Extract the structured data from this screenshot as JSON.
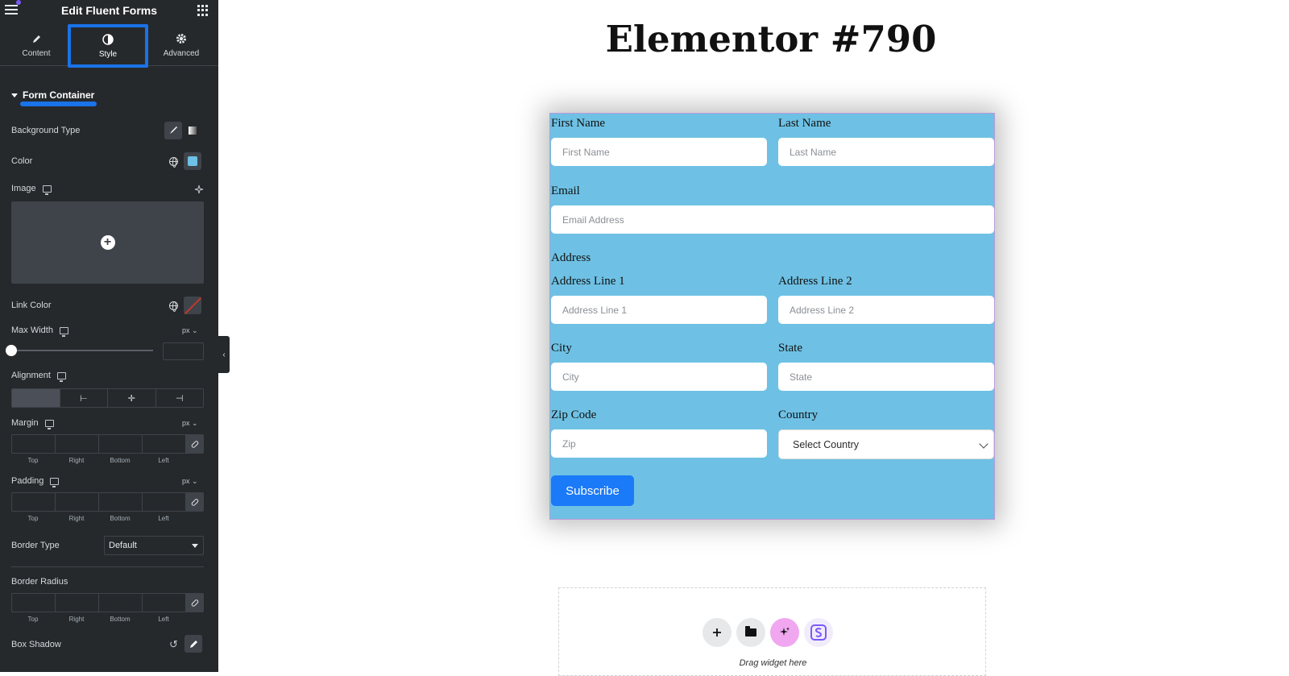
{
  "sidebar": {
    "title": "Edit Fluent Forms",
    "tabs": [
      {
        "label": "Content",
        "icon": "pencil-icon"
      },
      {
        "label": "Style",
        "icon": "half-circle-icon",
        "active": true
      },
      {
        "label": "Advanced",
        "icon": "gear-icon"
      }
    ],
    "section_title": "Form Container",
    "labels": {
      "background_type": "Background Type",
      "color": "Color",
      "image": "Image",
      "link_color": "Link Color",
      "max_width": "Max Width",
      "alignment": "Alignment",
      "margin": "Margin",
      "padding": "Padding",
      "border_type": "Border Type",
      "border_radius": "Border Radius",
      "box_shadow": "Box Shadow"
    },
    "unit": "px",
    "dimension_labels": {
      "top": "Top",
      "right": "Right",
      "bottom": "Bottom",
      "left": "Left"
    },
    "border_type_value": "Default",
    "colors": {
      "background_swatch": "#6ec1e4",
      "accent": "#1a73e8"
    }
  },
  "canvas": {
    "page_title": "Elementor #790",
    "form": {
      "first_name_label": "First Name",
      "first_name_placeholder": "First Name",
      "last_name_label": "Last Name",
      "last_name_placeholder": "Last Name",
      "email_label": "Email",
      "email_placeholder": "Email Address",
      "address_label": "Address",
      "address1_label": "Address Line 1",
      "address1_placeholder": "Address Line 1",
      "address2_label": "Address Line 2",
      "address2_placeholder": "Address Line 2",
      "city_label": "City",
      "city_placeholder": "City",
      "state_label": "State",
      "state_placeholder": "State",
      "zip_label": "Zip Code",
      "zip_placeholder": "Zip",
      "country_label": "Country",
      "country_value": "Select Country",
      "submit_label": "Subscribe",
      "background_color": "#6ec1e4"
    },
    "drop_zone_text": "Drag widget here"
  }
}
